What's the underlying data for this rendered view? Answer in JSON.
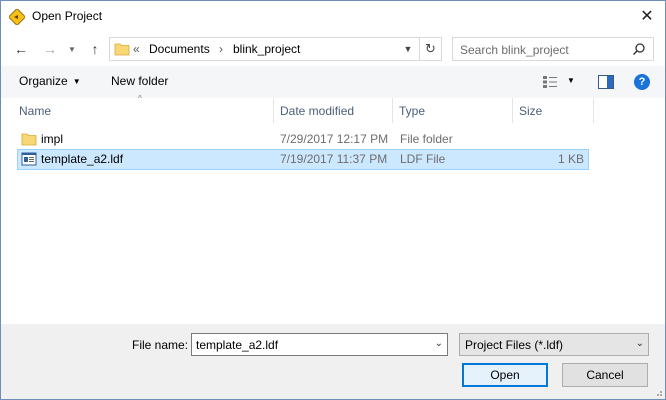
{
  "window": {
    "title": "Open Project",
    "close_symbol": "✕"
  },
  "nav": {
    "back_symbol": "←",
    "forward_symbol": "→",
    "up_symbol": "↑",
    "address": {
      "overflow": "«",
      "segments": [
        "Documents",
        "blink_project"
      ],
      "separator": "›"
    },
    "search_placeholder": "Search blink_project"
  },
  "toolbar": {
    "organize_label": "Organize",
    "new_folder_label": "New folder",
    "help_label": "?"
  },
  "columns": [
    "Name",
    "Date modified",
    "Type",
    "Size"
  ],
  "rows": [
    {
      "name": "impl",
      "date": "7/29/2017 12:17 PM",
      "type": "File folder",
      "size": "",
      "icon": "folder-icon",
      "selected": false
    },
    {
      "name": "template_a2.ldf",
      "date": "7/19/2017 11:37 PM",
      "type": "LDF File",
      "size": "1 KB",
      "icon": "ldf-file-icon",
      "selected": true
    }
  ],
  "bottom": {
    "file_name_label": "File name:",
    "file_name_value": "template_a2.ldf",
    "filter_value": "Project Files (*.ldf)",
    "open_label": "Open",
    "cancel_label": "Cancel"
  },
  "colors": {
    "accent": "#0078d7",
    "selection": "#cce8ff",
    "folder": "#f8d775"
  }
}
